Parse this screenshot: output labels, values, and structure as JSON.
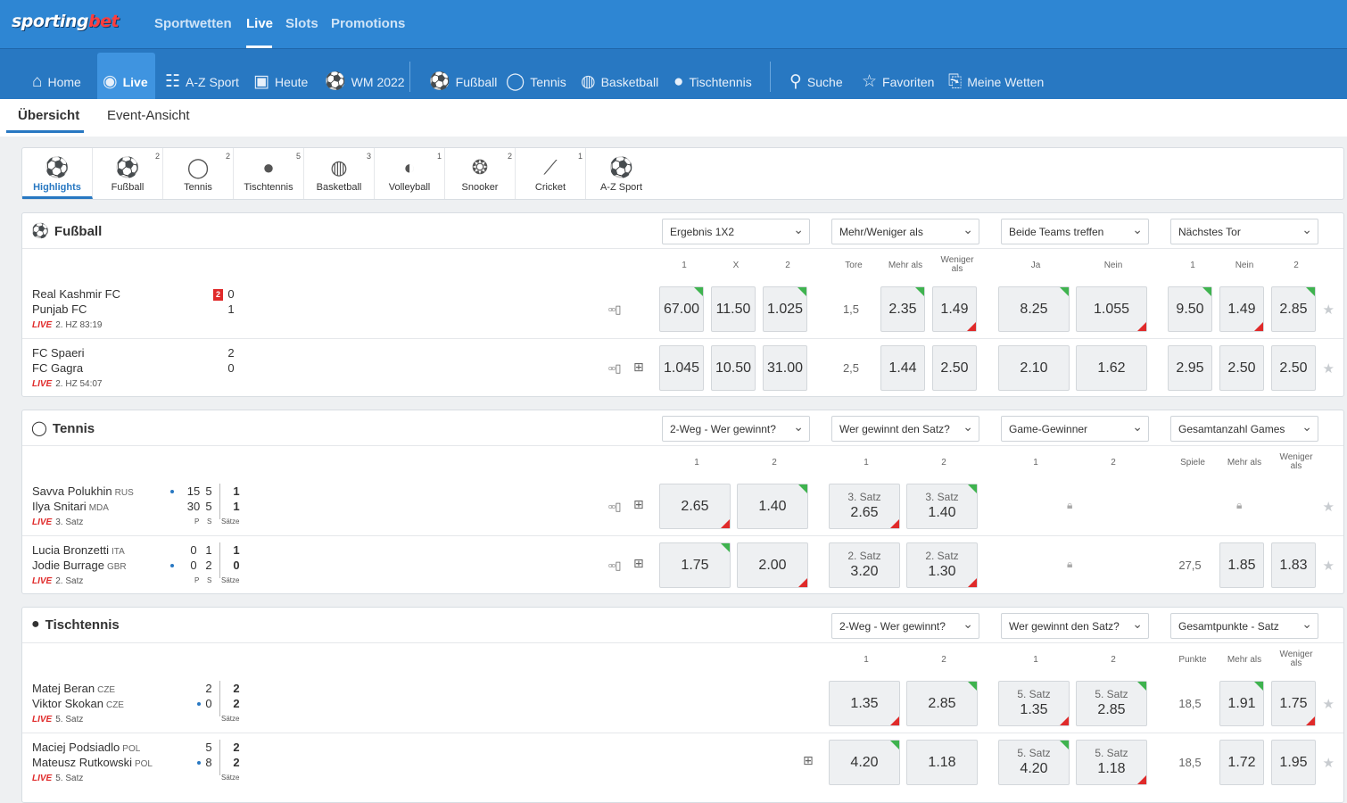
{
  "brand": {
    "a": "sporting",
    "b": "bet"
  },
  "topnav": [
    "Sportwetten",
    "Live",
    "Slots",
    "Promotions"
  ],
  "nav": [
    "Home",
    "Live",
    "A-Z Sport",
    "Heute",
    "WM 2022",
    "Fußball",
    "Tennis",
    "Basketball",
    "Tischtennis",
    "Suche",
    "Favoriten",
    "Meine Wetten"
  ],
  "subtabs": [
    "Übersicht",
    "Event-Ansicht"
  ],
  "sports": [
    {
      "label": "Highlights",
      "count": ""
    },
    {
      "label": "Fußball",
      "count": "2"
    },
    {
      "label": "Tennis",
      "count": "2"
    },
    {
      "label": "Tischtennis",
      "count": "5"
    },
    {
      "label": "Basketball",
      "count": "3"
    },
    {
      "label": "Volleyball",
      "count": "1"
    },
    {
      "label": "Snooker",
      "count": "2"
    },
    {
      "label": "Cricket",
      "count": "1"
    },
    {
      "label": "A-Z Sport",
      "count": ""
    }
  ],
  "fussball": {
    "title": "Fußball",
    "markets": [
      "Ergebnis 1X2",
      "Mehr/Weniger als",
      "Beide Teams treffen",
      "Nächstes Tor"
    ],
    "cols": [
      "1",
      "X",
      "2",
      "Tore",
      "Mehr als",
      "Weniger als",
      "Ja",
      "Nein",
      "1",
      "Nein",
      "2"
    ],
    "rows": [
      {
        "p1": "Real Kashmir FC",
        "p2": "Punjab FC",
        "s1": "0",
        "s2": "1",
        "red": "2",
        "live": "LIVE",
        "status": "2. HZ 83:19",
        "odds": [
          "67.00",
          "11.50",
          "1.025",
          "2.35",
          "1.49",
          "8.25",
          "1.055",
          "9.50",
          "1.49",
          "2.85"
        ],
        "line": "1,5"
      },
      {
        "p1": "FC Spaeri",
        "p2": "FC Gagra",
        "s1": "2",
        "s2": "0",
        "live": "LIVE",
        "status": "2. HZ 54:07",
        "odds": [
          "1.045",
          "10.50",
          "31.00",
          "1.44",
          "2.50",
          "2.10",
          "1.62",
          "2.95",
          "2.50",
          "2.50"
        ],
        "line": "2,5"
      }
    ]
  },
  "tennis": {
    "title": "Tennis",
    "markets": [
      "2-Weg - Wer gewinnt?",
      "Wer gewinnt den Satz?",
      "Game-Gewinner",
      "Gesamtanzahl Games"
    ],
    "cols": [
      "1",
      "2",
      "1",
      "2",
      "1",
      "2",
      "Spiele",
      "Mehr als",
      "Weniger als"
    ],
    "hdr": {
      "p": "P",
      "s": "S",
      "saetze": "Sätze"
    },
    "rows": [
      {
        "p1": "Savva Polukhin",
        "c1": "RUS",
        "p2": "Ilya Snitari",
        "c2": "MDA",
        "pt1": "15",
        "pt2": "30",
        "g1": "5",
        "g2": "5",
        "st1": "1",
        "st2": "1",
        "live": "LIVE",
        "status": "3. Satz",
        "odds": [
          "2.65",
          "1.40"
        ],
        "setlabel": "3. Satz",
        "setodds": [
          "2.65",
          "1.40"
        ]
      },
      {
        "p1": "Lucia Bronzetti",
        "c1": "ITA",
        "p2": "Jodie Burrage",
        "c2": "GBR",
        "pt1": "0",
        "pt2": "0",
        "g1": "1",
        "g2": "2",
        "st1": "1",
        "st2": "0",
        "live": "LIVE",
        "status": "2. Satz",
        "odds": [
          "1.75",
          "2.00"
        ],
        "setlabel": "2. Satz",
        "setodds": [
          "3.20",
          "1.30"
        ],
        "line": "27,5",
        "ou": [
          "1.85",
          "1.83"
        ]
      }
    ]
  },
  "tischtennis": {
    "title": "Tischtennis",
    "markets": [
      "2-Weg - Wer gewinnt?",
      "Wer gewinnt den Satz?",
      "Gesamtpunkte - Satz"
    ],
    "cols": [
      "1",
      "2",
      "1",
      "2",
      "Punkte",
      "Mehr als",
      "Weniger als"
    ],
    "saetze": "Sätze",
    "rows": [
      {
        "p1": "Matej Beran",
        "c1": "CZE",
        "p2": "Viktor Skokan",
        "c2": "CZE",
        "pt1": "2",
        "pt2": "0",
        "st1": "2",
        "st2": "2",
        "live": "LIVE",
        "status": "5. Satz",
        "odds": [
          "1.35",
          "2.85"
        ],
        "setlabel": "5. Satz",
        "setodds": [
          "1.35",
          "2.85"
        ],
        "line": "18,5",
        "ou": [
          "1.91",
          "1.75"
        ]
      },
      {
        "p1": "Maciej Podsiadlo",
        "c1": "POL",
        "p2": "Mateusz Rutkowski",
        "c2": "POL",
        "pt1": "5",
        "pt2": "8",
        "st1": "2",
        "st2": "2",
        "live": "LIVE",
        "status": "5. Satz",
        "odds": [
          "4.20",
          "1.18"
        ],
        "setlabel": "5. Satz",
        "setodds": [
          "4.20",
          "1.18"
        ],
        "line": "18,5",
        "ou": [
          "1.72",
          "1.95"
        ]
      }
    ]
  }
}
